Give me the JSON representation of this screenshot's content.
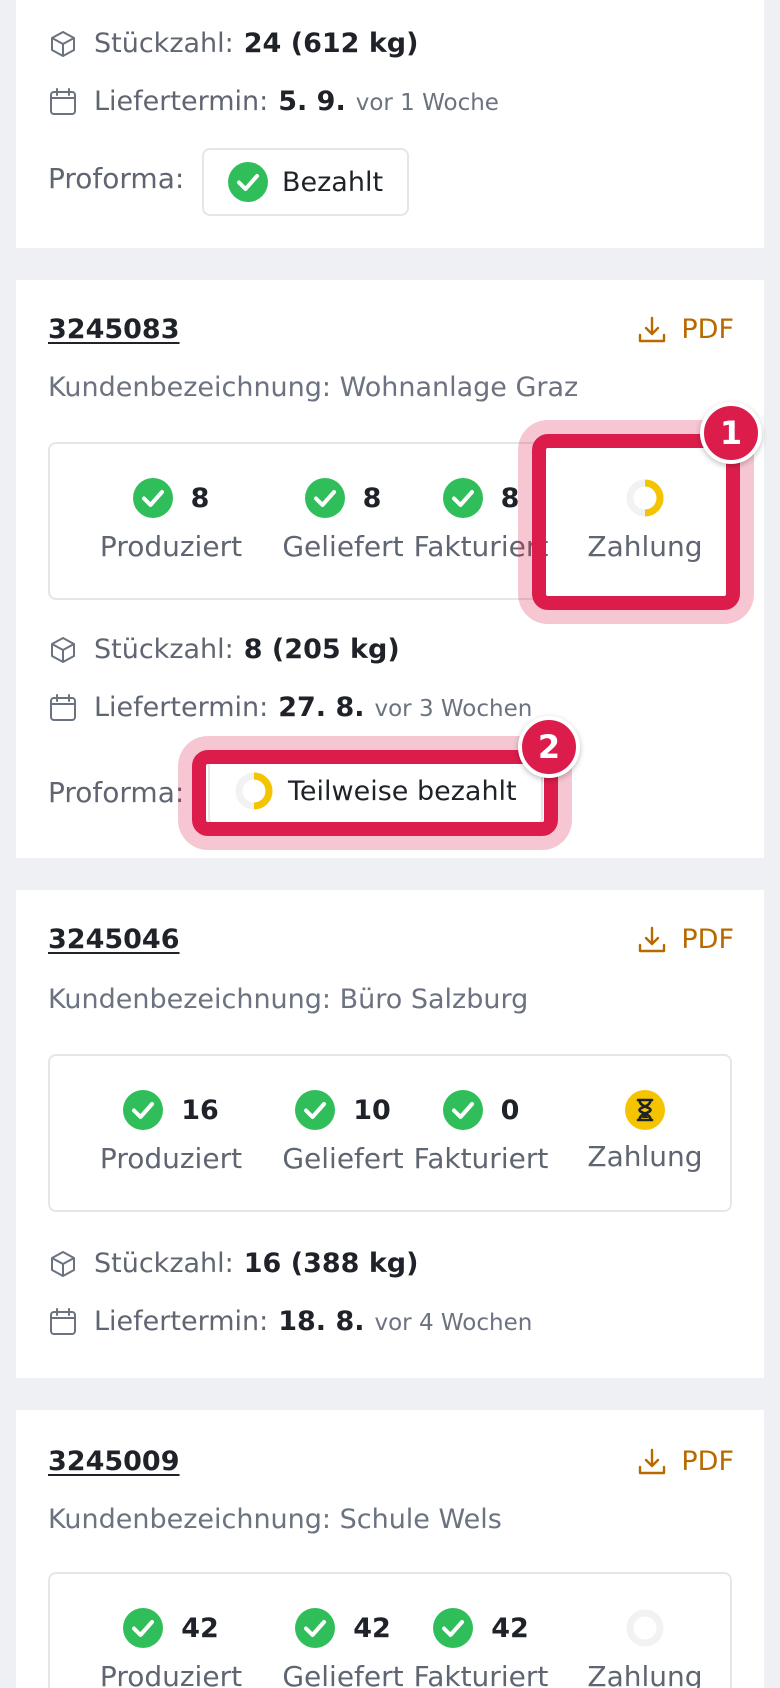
{
  "colors": {
    "success": "#2fbe5a",
    "pending": "#f5c400",
    "pdf": "#b86a00",
    "highlight": "#dc1d4b"
  },
  "card0": {
    "quantity_label": "Stückzahl:",
    "quantity_value": "24 (612 kg)",
    "delivery_label": "Liefertermin:",
    "delivery_date": "5. 9.",
    "delivery_relative": "vor 1 Woche",
    "proforma_label": "Proforma:",
    "proforma_status": "Bezahlt"
  },
  "card1": {
    "order_number": "3245083",
    "pdf_label": "PDF",
    "customer": "Kundenbezeichnung: Wohnanlage Graz",
    "statuses": [
      {
        "count": "8",
        "label": "Produziert",
        "icon": "check-icon"
      },
      {
        "count": "8",
        "label": "Geliefert",
        "icon": "check-icon"
      },
      {
        "count": "8",
        "label": "Fakturiert",
        "icon": "check-icon"
      },
      {
        "count": "",
        "label": "Zahlung",
        "icon": "partial-payment-icon"
      }
    ],
    "quantity_label": "Stückzahl:",
    "quantity_value": "8 (205 kg)",
    "delivery_label": "Liefertermin:",
    "delivery_date": "27. 8.",
    "delivery_relative": "vor 3 Wochen",
    "proforma_label": "Proforma:",
    "proforma_status": "Teilweise bezahlt"
  },
  "card2": {
    "order_number": "3245046",
    "pdf_label": "PDF",
    "customer": "Kundenbezeichnung: Büro Salzburg",
    "statuses": [
      {
        "count": "16",
        "label": "Produziert",
        "icon": "check-icon"
      },
      {
        "count": "10",
        "label": "Geliefert",
        "icon": "check-icon"
      },
      {
        "count": "0",
        "label": "Fakturiert",
        "icon": "check-icon"
      },
      {
        "count": "",
        "label": "Zahlung",
        "icon": "hourglass-icon"
      }
    ],
    "quantity_label": "Stückzahl:",
    "quantity_value": "16 (388 kg)",
    "delivery_label": "Liefertermin:",
    "delivery_date": "18. 8.",
    "delivery_relative": "vor 4 Wochen"
  },
  "card3": {
    "order_number": "3245009",
    "pdf_label": "PDF",
    "customer": "Kundenbezeichnung: Schule Wels",
    "statuses": [
      {
        "count": "42",
        "label": "Produziert",
        "icon": "check-icon"
      },
      {
        "count": "42",
        "label": "Geliefert",
        "icon": "check-icon"
      },
      {
        "count": "42",
        "label": "Fakturiert",
        "icon": "check-icon"
      },
      {
        "count": "",
        "label": "Zahlung",
        "icon": "empty-circle-icon"
      }
    ]
  },
  "annotations": [
    {
      "number": "1"
    },
    {
      "number": "2"
    }
  ]
}
